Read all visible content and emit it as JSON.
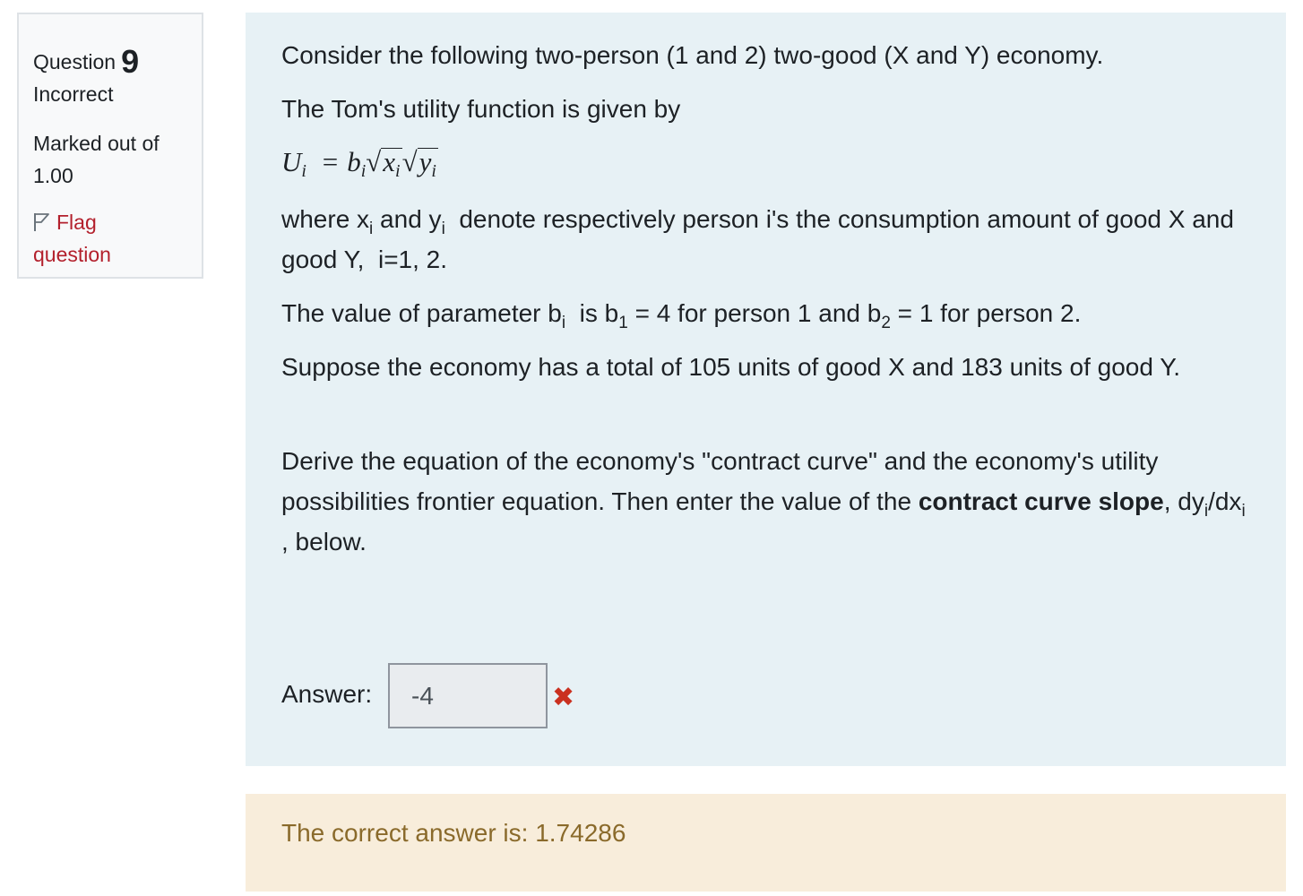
{
  "info": {
    "question_label": "Question",
    "question_number": "9",
    "state": "Incorrect",
    "grade_line1": "Marked out of",
    "grade_line2": "1.00",
    "flag_line1": "Flag",
    "flag_line2": "question",
    "flag_icon": "flag-outline-icon"
  },
  "question": {
    "p1": "Consider the following two-person (1 and 2) two-good (X and Y) economy.",
    "p2": "The Tom's utility function is given by",
    "formula": {
      "U": "U",
      "i": "i",
      "eq": "=",
      "b": "b",
      "x": "x",
      "y": "y"
    },
    "p3": {
      "a": "where x",
      "sub1": "i",
      "b": " and y",
      "sub2": "i",
      "c": "  denote respectively person i's the consumption amount of good X and good Y,  i=1, 2."
    },
    "p4": {
      "a": "The value of parameter b",
      "sub1": "i",
      "b": "  is b",
      "sub2": "1",
      "c": " = 4 for person 1 and b",
      "sub3": "2",
      "d": " = 1 for person 2."
    },
    "p5": "Suppose the economy has a total of 105 units of good X and 183 units of good Y.",
    "p6": {
      "a": "Derive the equation of the economy's \"contract curve\" and the economy's utility possibilities frontier equation. Then enter the value of the ",
      "bold": "contract curve slope",
      "b": ", dy",
      "sub1": "i",
      "c": "/dx",
      "sub2": "i",
      "d": " , below."
    }
  },
  "answer": {
    "label": "Answer:",
    "value": "-4",
    "status_icon": "incorrect-cross-icon",
    "status_color": "#ca3120"
  },
  "feedback": {
    "right_answer": "The correct answer is: 1.74286"
  },
  "colors": {
    "flag": "#b3202c",
    "formulation_bg": "#e7f1f5",
    "feedback_bg": "#f8eddb",
    "feedback_text": "#8a6a2b"
  }
}
